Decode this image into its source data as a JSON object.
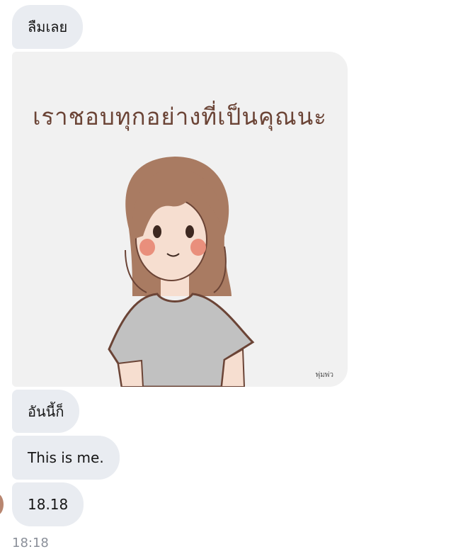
{
  "messages": [
    {
      "text": "ลืมเลย"
    },
    {
      "image_caption": "เราชอบทุกอย่างที่เป็นคุณนะ",
      "image_signature": "พุ่มพ่ว"
    },
    {
      "text": "อันนี้ก็"
    },
    {
      "text": "This is me."
    },
    {
      "text": "18.18"
    }
  ],
  "timestamp": "18:18",
  "colors": {
    "bubble": "#e9ecf1",
    "image_bg": "#f1f1f1",
    "text": "#161616",
    "timestamp": "#8a8f99"
  },
  "icons": {
    "avatar": "avatar-icon"
  }
}
